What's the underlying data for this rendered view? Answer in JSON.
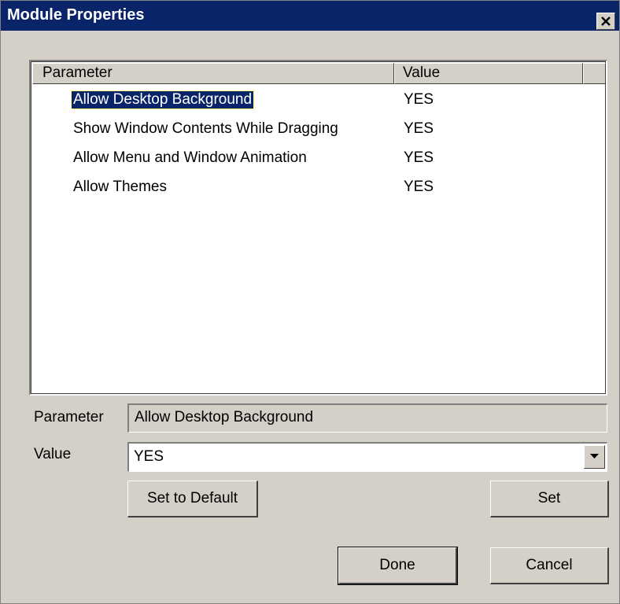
{
  "window": {
    "title": "Module Properties"
  },
  "list": {
    "columns": [
      "Parameter",
      "Value"
    ],
    "rows": [
      {
        "parameter": "Allow Desktop Background",
        "value": "YES",
        "selected": true
      },
      {
        "parameter": "Show Window Contents While Dragging",
        "value": "YES",
        "selected": false
      },
      {
        "parameter": "Allow Menu and Window Animation",
        "value": "YES",
        "selected": false
      },
      {
        "parameter": "Allow Themes",
        "value": "YES",
        "selected": false
      }
    ]
  },
  "form": {
    "parameter_label": "Parameter",
    "parameter_value": "Allow Desktop Background",
    "value_label": "Value",
    "value_selected": "YES"
  },
  "buttons": {
    "set_default": "Set to Default",
    "set": "Set",
    "done": "Done",
    "cancel": "Cancel"
  },
  "icons": {
    "close": "close-icon",
    "dropdown": "chevron-down-icon"
  }
}
